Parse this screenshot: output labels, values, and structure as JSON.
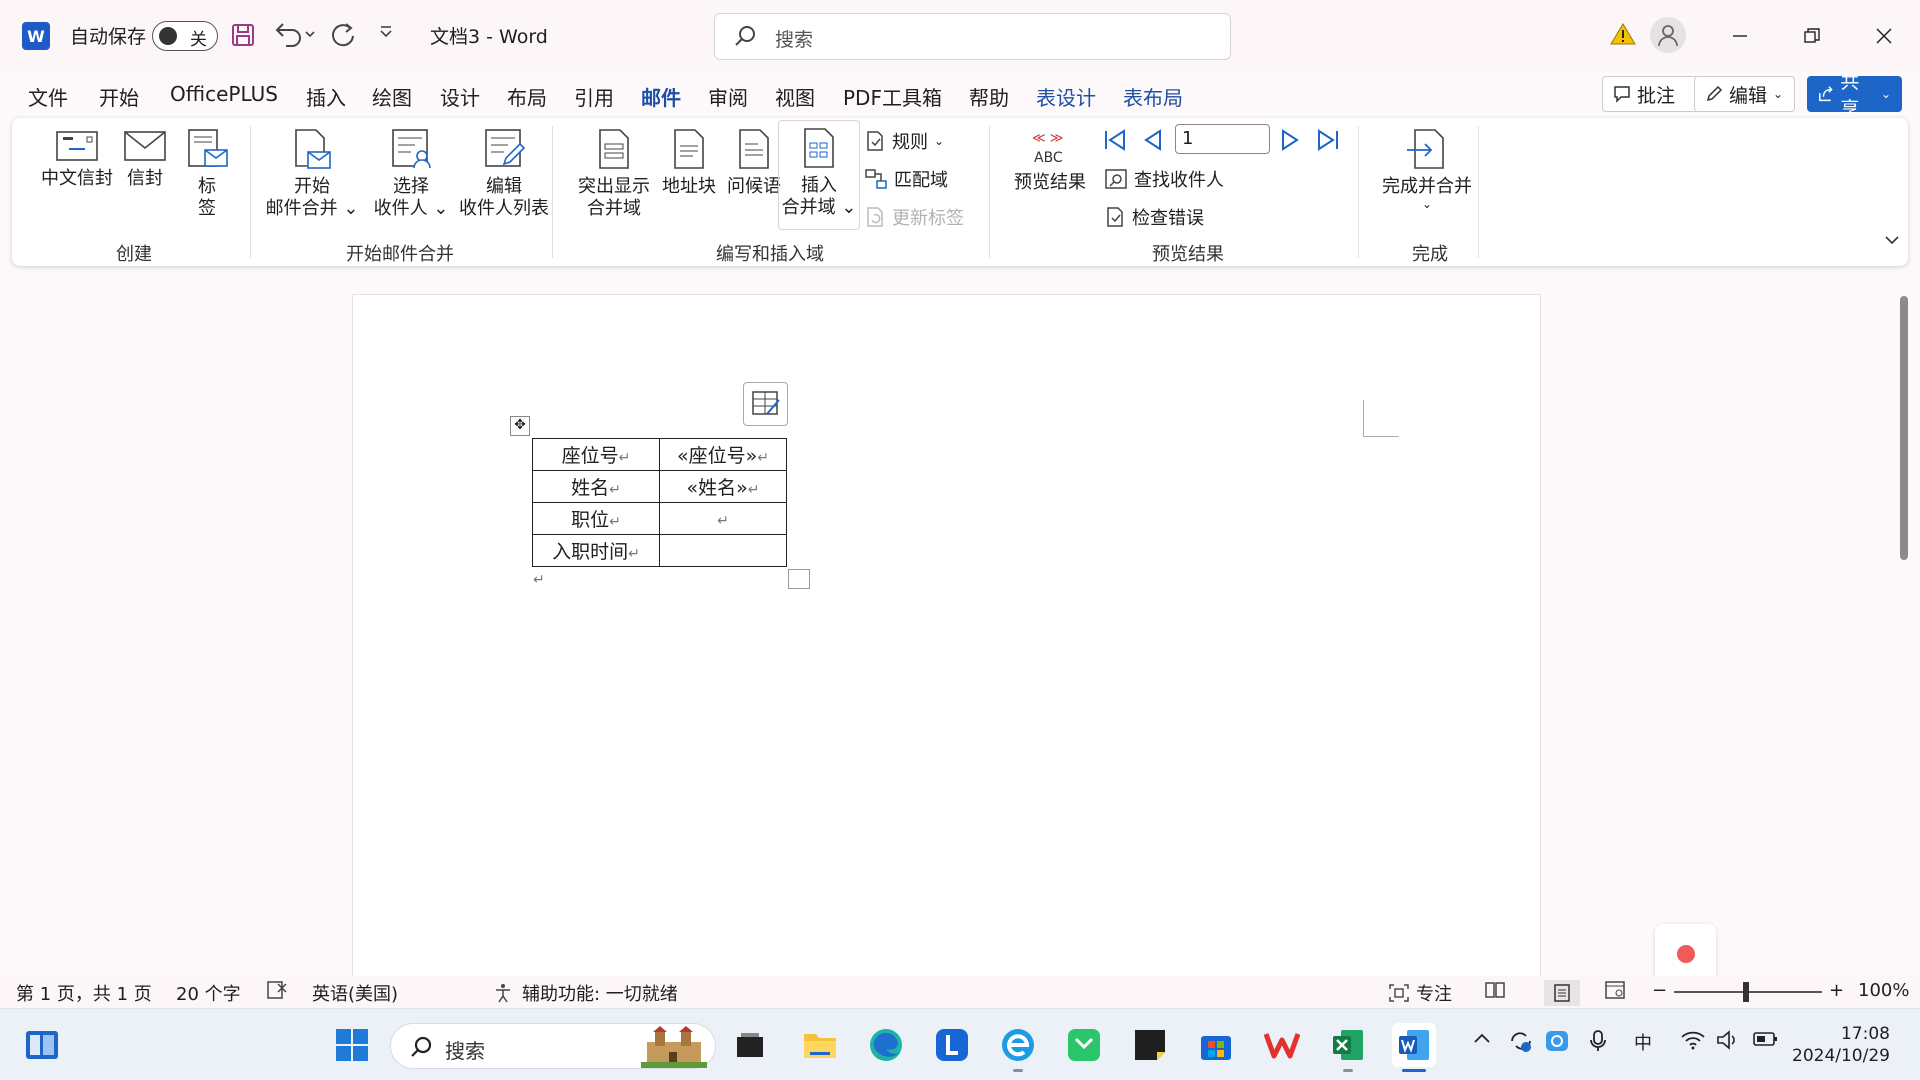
{
  "titlebar": {
    "app_logo": "W",
    "autosave_label": "自动保存",
    "autosave_state": "关",
    "doc_title": "文档3  -  Word",
    "search_placeholder": "搜索",
    "icons": [
      "word-logo-icon",
      "save-icon",
      "undo-icon",
      "redo-icon",
      "customize-qat-icon",
      "warning-icon",
      "user-avatar-icon"
    ]
  },
  "tabs": [
    {
      "label": "文件"
    },
    {
      "label": "开始"
    },
    {
      "label": "OfficePLUS"
    },
    {
      "label": "插入"
    },
    {
      "label": "绘图"
    },
    {
      "label": "设计"
    },
    {
      "label": "布局"
    },
    {
      "label": "引用"
    },
    {
      "label": "邮件",
      "active": true
    },
    {
      "label": "审阅"
    },
    {
      "label": "视图"
    },
    {
      "label": "PDF工具箱"
    },
    {
      "label": "帮助"
    },
    {
      "label": "表设计",
      "context": true
    },
    {
      "label": "表布局",
      "context": true
    }
  ],
  "top_buttons": {
    "comments": "批注",
    "editing": "编辑",
    "share": "共享"
  },
  "ribbon": {
    "create": {
      "label": "创建",
      "chinese_envelope": "中文信封",
      "envelope": "信封",
      "labels_1": "标",
      "labels_2": "签"
    },
    "start_merge": {
      "label": "开始邮件合并",
      "start_1": "开始",
      "start_2": "邮件合并",
      "select_1": "选择",
      "select_2": "收件人",
      "edit_1": "编辑",
      "edit_2": "收件人列表"
    },
    "write_insert": {
      "label": "编写和插入域",
      "highlight_1": "突出显示",
      "highlight_2": "合并域",
      "address_block": "地址块",
      "greeting": "问候语",
      "insert_1": "插入",
      "insert_2": "合并域",
      "rules": "规则",
      "match_fields": "匹配域",
      "update_labels": "更新标签"
    },
    "preview": {
      "label": "预览结果",
      "preview_results": "预览结果",
      "record": "1",
      "find_recipient": "查找收件人",
      "check_errors": "检查错误",
      "abc": "ABC"
    },
    "finish": {
      "label": "完成",
      "finish_merge": "完成并合并"
    }
  },
  "document": {
    "table": [
      {
        "label": "座位号",
        "value": "«座位号»"
      },
      {
        "label": "姓名",
        "value": "«姓名»"
      },
      {
        "label": "职位",
        "value": ""
      },
      {
        "label": "入职时间",
        "value": ""
      }
    ],
    "return_mark": "↵"
  },
  "statusbar": {
    "page": "第 1 页，共 1 页",
    "words": "20 个字",
    "language": "英语(美国)",
    "accessibility": "辅助功能: 一切就绪",
    "focus": "专注",
    "zoom": "100%",
    "zoom_minus": "−",
    "zoom_plus": "+"
  },
  "taskbar": {
    "search_placeholder": "搜索",
    "ime": "中",
    "time": "17:08",
    "date": "2024/10/29"
  },
  "colors": {
    "accent": "#1e4ea5",
    "share": "#1d66c8",
    "record": "#f05a5a"
  }
}
